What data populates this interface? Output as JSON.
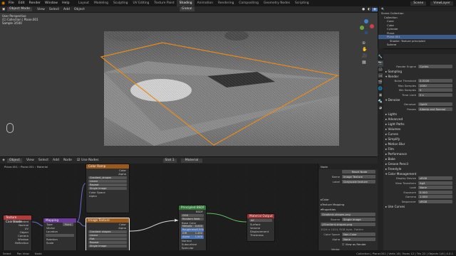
{
  "menus": [
    "File",
    "Edit",
    "Render",
    "Window",
    "Help"
  ],
  "workspaces": [
    "Layout",
    "Modeling",
    "Sculpting",
    "UV Editing",
    "Texture Paint",
    "Shading",
    "Animation",
    "Rendering",
    "Compositing",
    "Geometry Nodes",
    "Scripting"
  ],
  "active_workspace": "Shading",
  "scene": {
    "label": "Scene",
    "view_layer": "ViewLayer"
  },
  "viewport": {
    "mode": "Object Mode",
    "menus": [
      "View",
      "Select",
      "Add",
      "Object"
    ],
    "orientation": "Global",
    "overlay_lines": [
      "User Perspective",
      "(1) Collection | Plane.001",
      "Sample 3/500"
    ]
  },
  "node_editor": {
    "type": "Object",
    "menus": [
      "View",
      "Select",
      "Add",
      "Node"
    ],
    "use_nodes": "Use Nodes",
    "slot": "Slot 1",
    "material": "Material",
    "breadcrumb": [
      "Plane.001",
      "Plane.001",
      "Material"
    ],
    "nodes": {
      "texcoord": {
        "title": "Texture Coordinate",
        "outputs": [
          "Generated",
          "Normal",
          "UV",
          "Object",
          "Camera",
          "Window",
          "Reflection"
        ]
      },
      "mapping": {
        "title": "Mapping",
        "type_label": "Type",
        "type_value": "Point",
        "inputs": [
          "Vector",
          "Location",
          "Rotation",
          "Scale"
        ]
      },
      "tex1": {
        "title": "Color Ramp",
        "image": "Gradient_shapes",
        "fields": [
          "Linear",
          "Repeat",
          "Single Image",
          "Color Space",
          "Alpha"
        ],
        "outputs": [
          "Color",
          "Alpha"
        ]
      },
      "tex2": {
        "title": "Image Texture",
        "image": "Gradient shapes",
        "fields": [
          "Linear",
          "Flat",
          "Repeat",
          "Single Image"
        ],
        "outputs": [
          "Color",
          "Alpha"
        ]
      },
      "bsdf": {
        "title": "Principled BSDF",
        "output": "BSDF",
        "rows": [
          "GGX",
          "Random Walk",
          "Base Color",
          "Metallic",
          "Roughness",
          "IOR",
          "Alpha",
          "Normal",
          "Subsurface",
          "Specular",
          "Transmission"
        ],
        "values": {
          "Metallic": "0.000",
          "Roughness": "0.500",
          "IOR": "1.450",
          "Alpha": "1.000"
        }
      },
      "output": {
        "title": "Material Output",
        "target": "All",
        "inputs": [
          "Surface",
          "Volume",
          "Displacement",
          "Thickness"
        ]
      }
    }
  },
  "npanel": {
    "tab_node": "Node",
    "header": "Reset Node",
    "name_label": "Name",
    "name_value": "Image Texture",
    "label_label": "Label",
    "label_value": "Grayscale texture",
    "sections": [
      "Color",
      "Texture Mapping",
      "Properties"
    ],
    "image": "Gradient-shapes.png",
    "source_label": "Source",
    "source_value": "Single Image",
    "filepath": "//Gradient-shapes.png",
    "info": "1024 x 1024, RGB byte, Flatten",
    "colorspace_label": "Color Space",
    "colorspace_value": "Non-Color",
    "alpha_label": "Alpha",
    "alpha_value": "None",
    "view_as_render": "View as Render",
    "vector_label": "Vector"
  },
  "outliner": {
    "title": "Scene Collection",
    "items": [
      "Collection",
      "Cone",
      "Cube",
      "Cylinder",
      "Plane",
      "Plane.001",
      "Shader: Texture principled",
      "Sphere"
    ],
    "selected": "Plane.001"
  },
  "properties": {
    "render_engine_label": "Render Engine",
    "render_engine": "Cycles",
    "sections": [
      {
        "title": "Sampling",
        "rows": []
      },
      {
        "title": "Render",
        "rows": [
          [
            "Noise Threshold",
            "0.0100"
          ],
          [
            "Max Samples",
            "1000"
          ],
          [
            "Min Samples",
            "0"
          ],
          [
            "Time Limit",
            "0 s"
          ]
        ]
      },
      {
        "title": "Denoise",
        "rows": [
          [
            "Denoiser",
            "OptiX"
          ],
          [
            "Passes",
            "Albedo and Normal"
          ]
        ]
      },
      {
        "title": "Lights",
        "rows": []
      },
      {
        "title": "Advanced",
        "rows": []
      },
      {
        "title": "Light Paths",
        "rows": []
      },
      {
        "title": "Volumes",
        "rows": []
      },
      {
        "title": "Curves",
        "rows": []
      },
      {
        "title": "Simplify",
        "rows": []
      },
      {
        "title": "Motion Blur",
        "rows": []
      },
      {
        "title": "Film",
        "rows": []
      },
      {
        "title": "Performance",
        "rows": []
      },
      {
        "title": "Bake",
        "rows": []
      },
      {
        "title": "Grease Pencil",
        "rows": []
      },
      {
        "title": "Freestyle",
        "rows": []
      },
      {
        "title": "Color Management",
        "rows": [
          [
            "Display Device",
            "sRGB"
          ],
          [
            "View Transform",
            "AgX"
          ],
          [
            "Look",
            "None"
          ],
          [
            "Exposure",
            "0.000"
          ],
          [
            "Gamma",
            "1.000"
          ],
          [
            "Sequencer",
            "sRGB"
          ]
        ]
      },
      {
        "title": "Use Curves",
        "rows": []
      }
    ]
  },
  "status": {
    "left": [
      "Select",
      "Pan View",
      "Node"
    ],
    "right": "Collection | Plane.001 | Verts 18 | Faces 12 | Tris 22 | Objects 1/6 | 4.0.1"
  }
}
